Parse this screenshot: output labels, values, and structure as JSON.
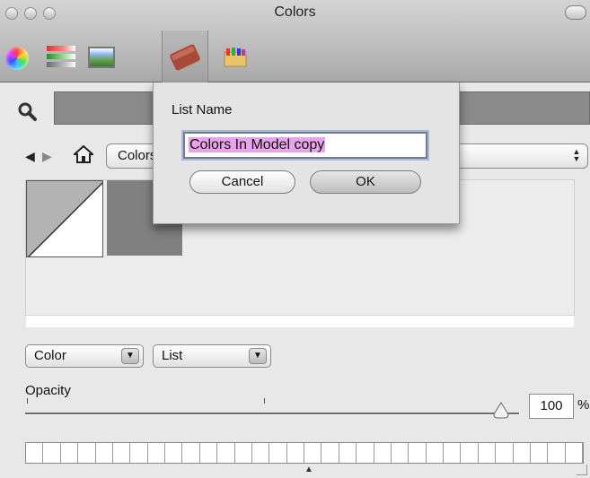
{
  "window": {
    "title": "Colors",
    "tabs": [
      {
        "name": "color-wheel-icon"
      },
      {
        "name": "color-sliders-icon"
      },
      {
        "name": "image-palettes-icon"
      },
      {
        "name": "crayons-icon",
        "selected": true
      },
      {
        "name": "pencils-icon"
      }
    ]
  },
  "search": {
    "value": ""
  },
  "nav": {
    "list_value": "Colors In Model"
  },
  "sheet": {
    "label": "List Name",
    "input_value": "Colors In Model copy",
    "cancel_label": "Cancel",
    "ok_label": "OK"
  },
  "bottom": {
    "color_popup": "Color",
    "list_popup": "List",
    "opacity_label": "Opacity",
    "opacity_value": "100",
    "opacity_unit": "%"
  },
  "colors": {
    "selection_highlight": "#e9a3ec",
    "swatch_gray": "#808080",
    "search_field": "#8a8a8a"
  }
}
